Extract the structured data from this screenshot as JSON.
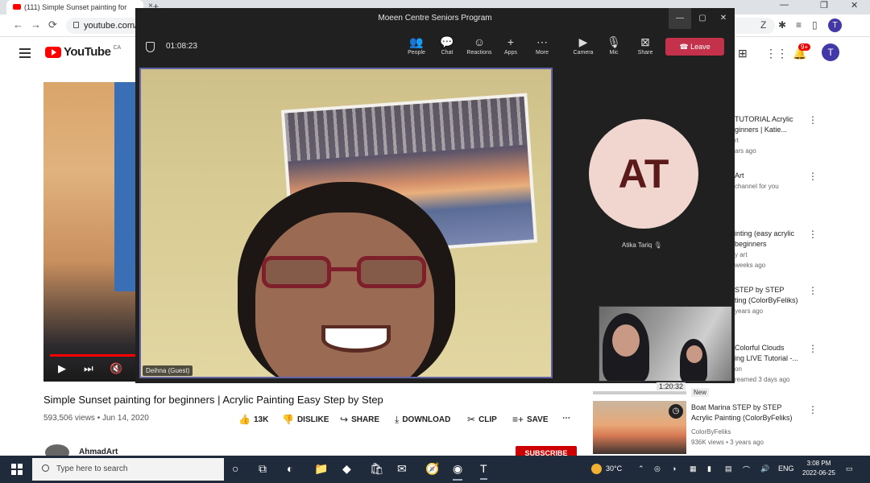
{
  "chrome": {
    "tab_title": "(111) Simple Sunset painting for",
    "tab_close": "×",
    "new_tab": "+",
    "url": "youtube.com/",
    "back": "←",
    "forward": "→",
    "reload": "⟳",
    "profile": "T"
  },
  "youtube": {
    "logo_text": "YouTube",
    "region": "CA",
    "notif_count": "9+",
    "avatar": "T",
    "video": {
      "title": "Simple Sunset painting for beginners | Acrylic Painting Easy Step by Step",
      "meta": "593,506 views • Jun 14, 2020",
      "progress_fraction": 0.95
    },
    "actions": {
      "likes": "13K",
      "dislike": "DISLIKE",
      "share": "SHARE",
      "download": "DOWNLOAD",
      "clip": "CLIP",
      "save": "SAVE",
      "more": "⋯"
    },
    "channel": "AhmadArt",
    "subscribe": "SUBSCRIBE",
    "recommendations": [
      {
        "title": "TUTORIAL Acrylic",
        "title2": "ginners | Katie...",
        "sub": "rt",
        "sub2": "ars ago"
      },
      {
        "title": "Art",
        "title2": "",
        "sub": "channel for you",
        "sub2": ""
      },
      {
        "title": "inting (easy acrylic",
        "title2": "beginners",
        "sub": "y art",
        "sub2": "weeks ago"
      },
      {
        "title": "STEP by STEP",
        "title2": "ting (ColorByFeliks)",
        "sub": "",
        "sub2": "years ago"
      },
      {
        "title": "Colorful Clouds",
        "title2": "ing LIVE Tutorial -...",
        "sub": "on",
        "sub2": "reamed 3 days ago"
      }
    ],
    "rec2": {
      "badge": "New",
      "title": "Boat Marina STEP by STEP",
      "title2": "Acrylic Painting (ColorByFeliks)",
      "channel": "ColorByFeliks",
      "meta": "936K views • 3 years ago"
    }
  },
  "teams": {
    "title": "Moeen Centre Seniors Program",
    "timer": "01:08:23",
    "toolbar": {
      "people": "People",
      "chat": "Chat",
      "reactions": "Reactions",
      "apps": "Apps",
      "more": "More",
      "camera": "Camera",
      "mic": "Mic",
      "share": "Share",
      "leave": "Leave"
    },
    "main_participant": "Deihna (Guest)",
    "avatar_initials": "AT",
    "avatar_name": "Atika Tariq",
    "self_time": "1:20:32"
  },
  "taskbar": {
    "search_placeholder": "Type here to search",
    "temperature": "30°C",
    "language": "ENG",
    "time": "3:08 PM",
    "date": "2022-06-25"
  }
}
